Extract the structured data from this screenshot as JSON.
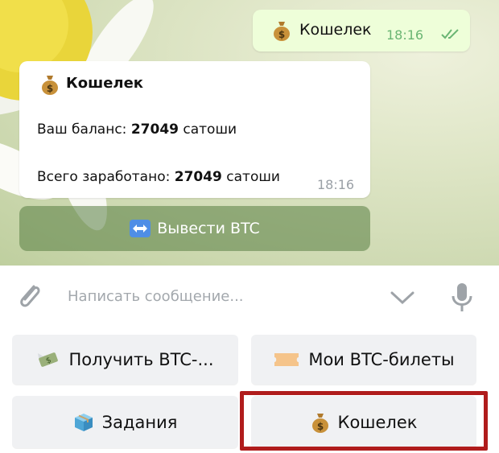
{
  "chat": {
    "outgoing": {
      "text": "Кошелек",
      "time": "18:16"
    },
    "incoming": {
      "title": "Кошелек",
      "balance_label": "Ваш баланс: ",
      "balance_value": "27049",
      "balance_unit": " сатоши",
      "earned_label": "Всего заработано: ",
      "earned_value": "27049",
      "earned_unit": " сатоши",
      "time": "18:16"
    },
    "inline_button": {
      "label": "Вывести BTC"
    }
  },
  "composer": {
    "placeholder": "Написать сообщение..."
  },
  "keyboard": {
    "buttons": [
      {
        "label": "Получить BTC-...",
        "icon": "money-wings-icon"
      },
      {
        "label": "Мои BTC-билеты",
        "icon": "ticket-icon"
      },
      {
        "label": "Задания",
        "icon": "package-icon"
      },
      {
        "label": "Кошелек",
        "icon": "money-bag-icon"
      }
    ]
  },
  "colors": {
    "outgoing_bubble": "#eefed9",
    "time_outgoing": "#6ab573",
    "highlight": "#b01c1c",
    "keyboard_button": "#f0f1f3"
  }
}
